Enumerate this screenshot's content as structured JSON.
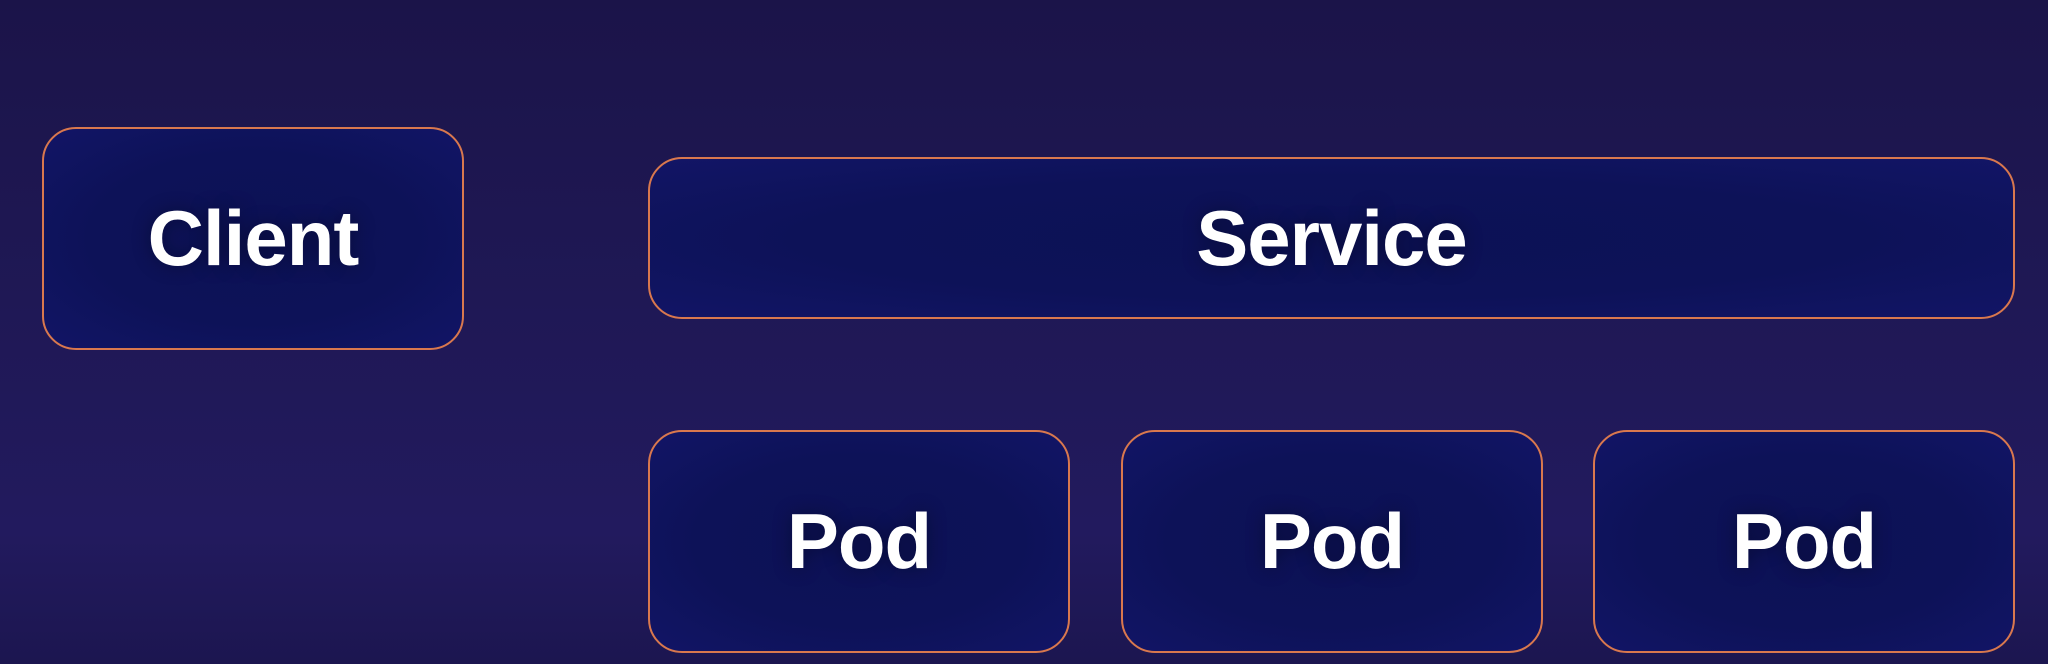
{
  "colors": {
    "background": "#1f1855",
    "node_fill": "#0d1258",
    "node_border": "#d9784e",
    "text": "#ffffff"
  },
  "nodes": {
    "client": {
      "label": "Client"
    },
    "service": {
      "label": "Service"
    },
    "pods": [
      {
        "label": "Pod"
      },
      {
        "label": "Pod"
      },
      {
        "label": "Pod"
      }
    ]
  }
}
